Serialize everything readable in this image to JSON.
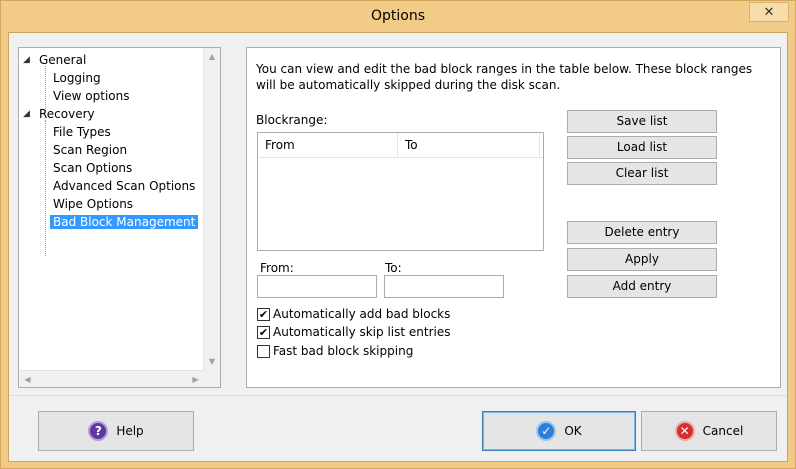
{
  "window": {
    "title": "Options",
    "close_glyph": "✕"
  },
  "tree": {
    "items": [
      {
        "label": "General",
        "level": 0,
        "toggle": "◢"
      },
      {
        "label": "Logging",
        "level": 1
      },
      {
        "label": "View options",
        "level": 1
      },
      {
        "label": "Recovery",
        "level": 0,
        "toggle": "◢"
      },
      {
        "label": "File Types",
        "level": 1
      },
      {
        "label": "Scan Region",
        "level": 1
      },
      {
        "label": "Scan Options",
        "level": 1
      },
      {
        "label": "Advanced Scan Options",
        "level": 1
      },
      {
        "label": "Wipe Options",
        "level": 1
      },
      {
        "label": "Bad Block Management",
        "level": 1,
        "selected": true
      }
    ]
  },
  "panel": {
    "description": "You can view and edit the bad block ranges in the table below. These block ranges will be automatically skipped during the disk scan.",
    "blockrange_label": "Blockrange:",
    "columns": {
      "from": "From",
      "to": "To"
    },
    "from_label": "From:",
    "to_label": "To:",
    "from_value": "",
    "to_value": "",
    "checkboxes": [
      {
        "label": "Automatically add bad blocks",
        "checked": true
      },
      {
        "label": "Automatically skip list entries",
        "checked": true
      },
      {
        "label": "Fast bad block skipping",
        "checked": false
      }
    ],
    "buttons": {
      "save_list": "Save list",
      "load_list": "Load list",
      "clear_list": "Clear list",
      "delete_entry": "Delete entry",
      "apply": "Apply",
      "add_entry": "Add entry"
    }
  },
  "footer": {
    "help": "Help",
    "ok": "OK",
    "cancel": "Cancel"
  },
  "colors": {
    "title_bar": "#f1cb87",
    "selection": "#3399ff",
    "dialog_bg": "#f0f0f0"
  }
}
